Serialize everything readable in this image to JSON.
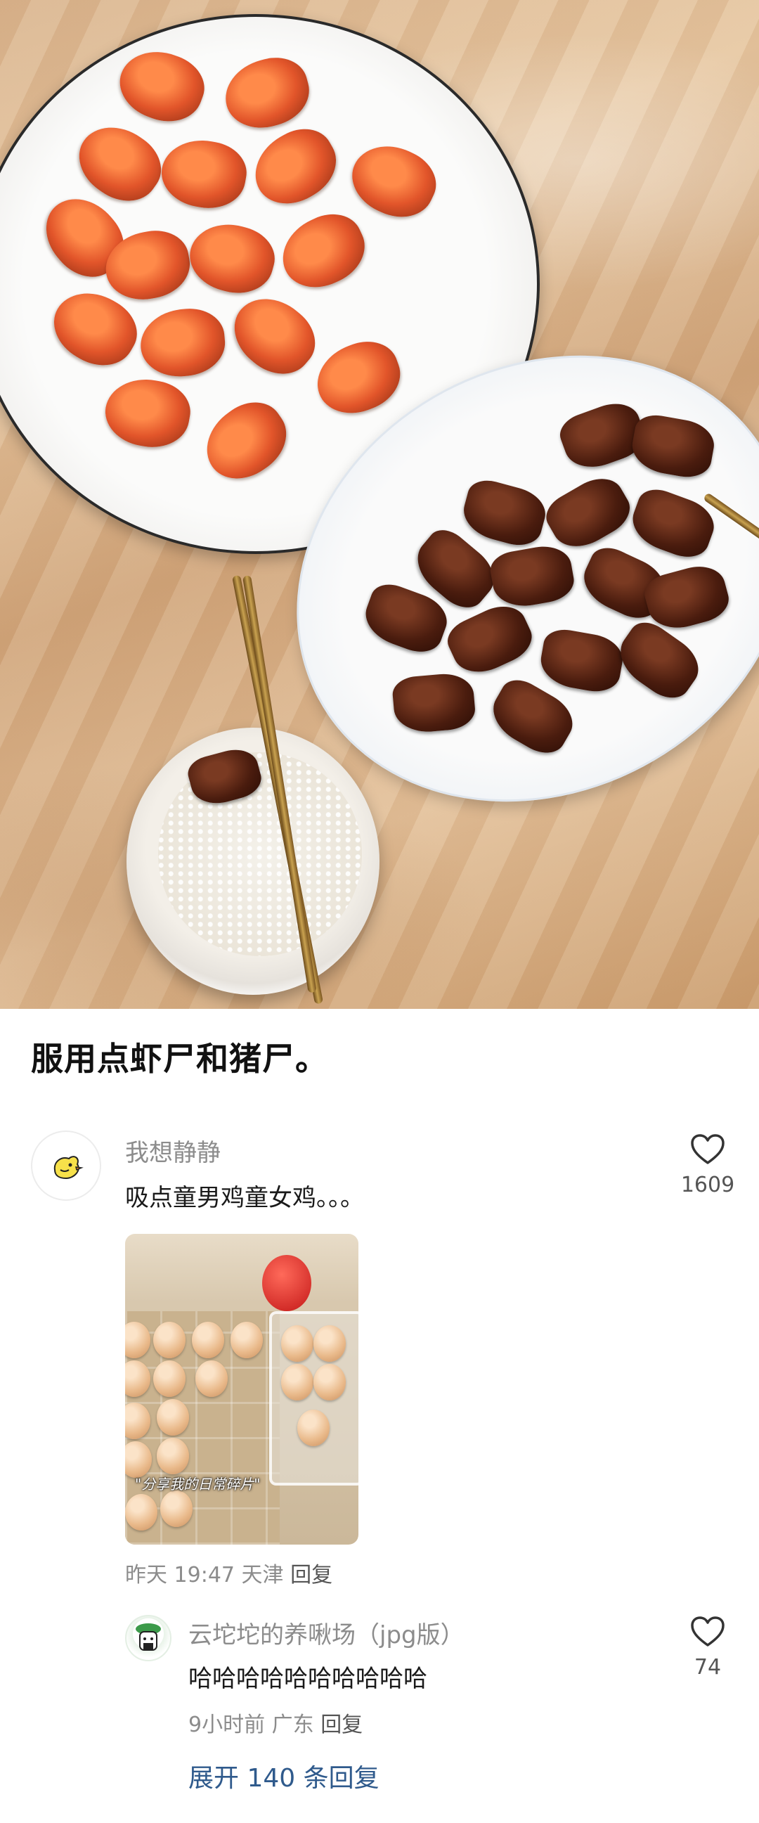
{
  "post": {
    "title": "服用点虾尸和猪尸。"
  },
  "comments": [
    {
      "username": "我想静静",
      "text": "吸点童男鸡童女鸡。。。",
      "likes": "1609",
      "time": "昨天 19:47",
      "location": "天津",
      "reply_label": "回复",
      "image_caption": "\"分享我的日常碎片\""
    },
    {
      "username": "云坨坨的养啾场（jpg版）",
      "text": "哈哈哈哈哈哈哈哈哈哈",
      "likes": "74",
      "time": "9小时前",
      "location": "广东",
      "reply_label": "回复"
    }
  ],
  "expand_replies": "展开 140 条回复",
  "icons": {
    "like": "heart-outline-icon",
    "avatar1": "chick-avatar-icon",
    "avatar2": "character-avatar-icon"
  },
  "colors": {
    "link": "#2f5a8c",
    "meta": "#8c8c8c"
  }
}
